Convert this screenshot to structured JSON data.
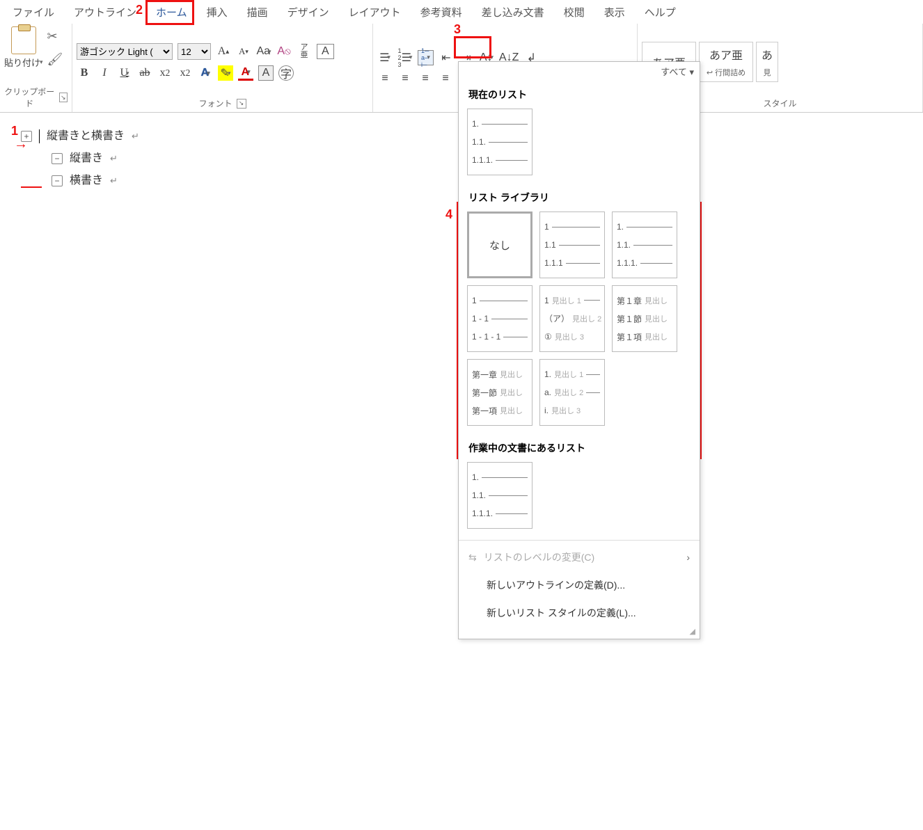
{
  "tabs": {
    "file": "ファイル",
    "outline": "アウトライン",
    "home": "ホーム",
    "insert": "挿入",
    "draw": "描画",
    "design": "デザイン",
    "layout": "レイアウト",
    "references": "参考資料",
    "mailings": "差し込み文書",
    "review": "校閲",
    "view": "表示",
    "help": "ヘルプ"
  },
  "ribbon": {
    "clipboard": {
      "paste": "貼り付け",
      "group": "クリップボード"
    },
    "font": {
      "name": "游ゴシック Light (",
      "size": "12",
      "group": "フォント"
    },
    "styles": {
      "group": "スタイル",
      "sample": "あア亜",
      "sample2": "あア亜",
      "sample3": "あ",
      "line_spacing": "↩ 行間詰め",
      "extra": "見"
    }
  },
  "doc": {
    "line1": "縦書きと横書き",
    "line2": "縦書き",
    "line3": "横書き"
  },
  "dropdown": {
    "all": "すべて ▾",
    "section_current": "現在のリスト",
    "section_library": "リスト ライブラリ",
    "section_in_doc": "作業中の文書にあるリスト",
    "none": "なし",
    "thumbs": {
      "cur": [
        "1.",
        "1.1.",
        "1.1.1."
      ],
      "lib_b": [
        "1",
        "1.1",
        "1.1.1"
      ],
      "lib_c": [
        "1.",
        "1.1.",
        "1.1.1."
      ],
      "lib_d": [
        "1",
        "1 - 1",
        "1 - 1 - 1"
      ],
      "lib_e_l1a": "1",
      "lib_e_l1b": "見出し 1",
      "lib_e_l2a": "（ア）",
      "lib_e_l2b": "見出し 2",
      "lib_e_l3a": "①",
      "lib_e_l3b": "見出し 3",
      "lib_f_l1a": "第１章",
      "lib_f_l1b": "見出し",
      "lib_f_l2a": "第１節",
      "lib_f_l2b": "見出し",
      "lib_f_l3a": "第１項",
      "lib_f_l3b": "見出し",
      "lib_g_l1a": "第一章",
      "lib_g_l1b": "見出し",
      "lib_g_l2a": "第一節",
      "lib_g_l2b": "見出し",
      "lib_g_l3a": "第一項",
      "lib_g_l3b": "見出し",
      "lib_h_l1a": "1.",
      "lib_h_l1b": "見出し 1",
      "lib_h_l2a": "a.",
      "lib_h_l2b": "見出し 2",
      "lib_h_l3a": "i.",
      "lib_h_l3b": "見出し 3",
      "doc": [
        "1.",
        "1.1.",
        "1.1.1."
      ]
    },
    "menu": {
      "change_level": "リストのレベルの変更(C)",
      "new_outline": "新しいアウトラインの定義(D)...",
      "new_list_style": "新しいリスト スタイルの定義(L)..."
    }
  },
  "annotations": {
    "1": "1",
    "2": "2",
    "3": "3",
    "4": "4"
  }
}
